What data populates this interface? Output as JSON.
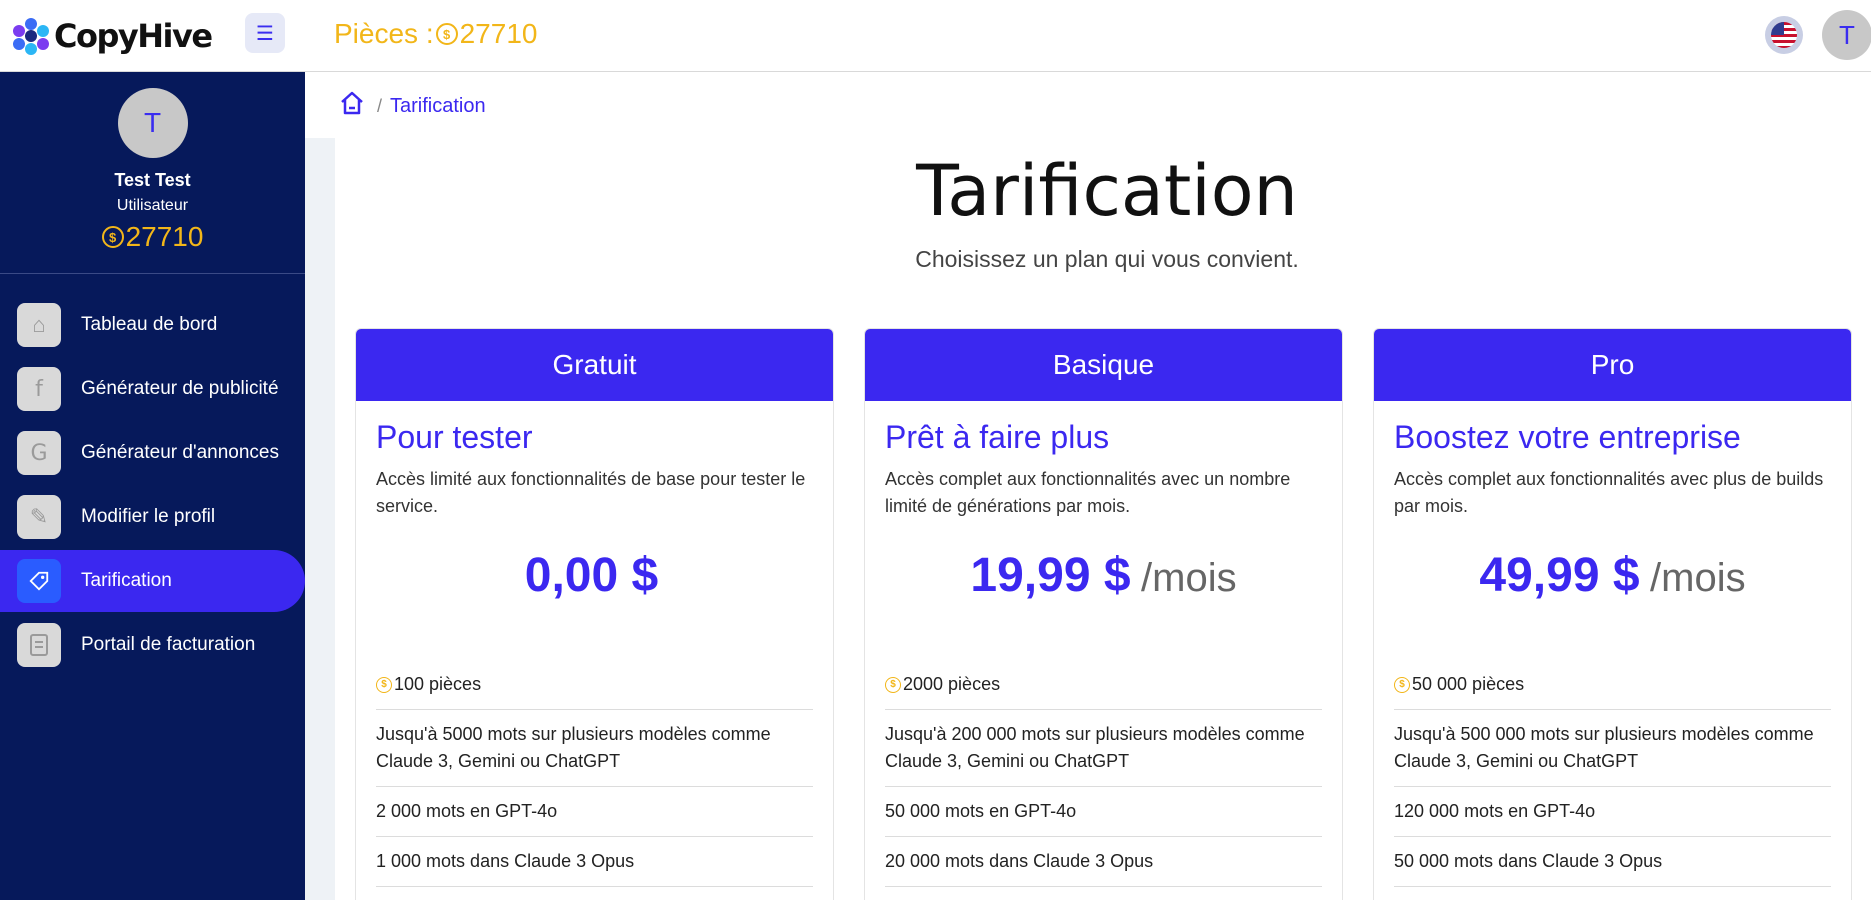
{
  "brand": {
    "name": "CopyHive"
  },
  "header": {
    "coins_label": "Pièces :",
    "coins_value": "27710",
    "avatar_initial": "T"
  },
  "sidebar": {
    "profile": {
      "initial": "T",
      "name": "Test Test",
      "role": "Utilisateur",
      "coins": "27710"
    },
    "items": [
      {
        "label": "Tableau de bord",
        "icon": "home-icon",
        "active": false
      },
      {
        "label": "Générateur de publicité",
        "icon": "facebook-icon",
        "active": false
      },
      {
        "label": "Générateur d'annonces",
        "icon": "google-icon",
        "active": false
      },
      {
        "label": "Modifier le profil",
        "icon": "pencil-icon",
        "active": false
      },
      {
        "label": "Tarification",
        "icon": "tag-icon",
        "active": true
      },
      {
        "label": "Portail de facturation",
        "icon": "document-icon",
        "active": false
      }
    ]
  },
  "breadcrumb": {
    "separator": "/",
    "current": "Tarification"
  },
  "page": {
    "title": "Tarification",
    "subtitle": "Choisissez un plan qui vous convient."
  },
  "plans": [
    {
      "name": "Gratuit",
      "tagline": "Pour tester",
      "description": "Accès limité aux fonctionnalités de base pour tester le service.",
      "price": "0,00 $",
      "period": "",
      "features": [
        "100 pièces",
        "Jusqu'à 5000 mots sur plusieurs modèles comme Claude 3, Gemini ou ChatGPT",
        "2 000 mots en GPT-4o",
        "1 000 mots dans Claude 3 Opus"
      ]
    },
    {
      "name": "Basique",
      "tagline": "Prêt à faire plus",
      "description": "Accès complet aux fonctionnalités avec un nombre limité de générations par mois.",
      "price": "19,99 $",
      "period": "/mois",
      "features": [
        "2000 pièces",
        "Jusqu'à 200 000 mots sur plusieurs modèles comme Claude 3, Gemini ou ChatGPT",
        "50 000 mots en GPT-4o",
        "20 000 mots dans Claude 3 Opus"
      ]
    },
    {
      "name": "Pro",
      "tagline": "Boostez votre entreprise",
      "description": "Accès complet aux fonctionnalités avec plus de builds par mois.",
      "price": "49,99 $",
      "period": "/mois",
      "features": [
        "50 000 pièces",
        "Jusqu'à 500 000 mots sur plusieurs modèles comme Claude 3, Gemini ou ChatGPT",
        "120 000 mots en GPT-4o",
        "50 000 mots dans Claude 3 Opus"
      ]
    }
  ],
  "colors": {
    "accent": "#3b28f0",
    "sidebar_bg": "#06195b",
    "coin": "#f2b619"
  }
}
